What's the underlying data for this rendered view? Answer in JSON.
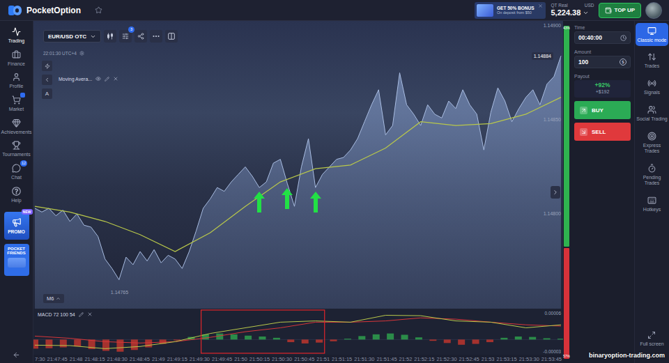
{
  "top_bar": {
    "logo": "PocketOption",
    "bonus": {
      "title": "GET 50% BONUS",
      "subtitle": "On deposit from $50"
    },
    "account": {
      "type": "QT Real",
      "currency": "USD",
      "balance": "5,224.38"
    },
    "top_up": "TOP UP"
  },
  "left_nav": {
    "items": [
      {
        "label": "Trading",
        "selected": true,
        "notify": false,
        "badge": null
      },
      {
        "label": "Finance",
        "selected": false,
        "notify": false,
        "badge": null
      },
      {
        "label": "Profile",
        "selected": false,
        "notify": false,
        "badge": null
      },
      {
        "label": "Market",
        "selected": false,
        "notify": true,
        "badge": null
      },
      {
        "label": "Achievements",
        "selected": false,
        "notify": false,
        "badge": null
      },
      {
        "label": "Tournaments",
        "selected": false,
        "notify": false,
        "badge": null
      },
      {
        "label": "Chat",
        "selected": false,
        "notify": false,
        "badge": "12"
      },
      {
        "label": "Help",
        "selected": false,
        "notify": false,
        "badge": null
      }
    ],
    "promo": {
      "label": "PROMO",
      "badge": "NEW"
    },
    "friends": {
      "label": "POCKET FRIENDS"
    }
  },
  "chart": {
    "symbol": "EUR/USD OTC",
    "indicator_count": "3",
    "time": "22:01:30 UTC+4",
    "text_tool": "A",
    "indicator": {
      "label": "Moving Avera..."
    },
    "timeframe": "M6",
    "price_axis": [
      {
        "label": "1.14900",
        "value": 1.149
      },
      {
        "label": "1.14850",
        "value": 1.1485
      },
      {
        "label": "1.14800",
        "value": 1.148
      }
    ],
    "current_price": {
      "label": "1.14884",
      "value": 1.14884
    },
    "low": {
      "label": "1.14765",
      "point": 12
    },
    "price": [
      1.14803,
      1.14801,
      1.14803,
      1.14799,
      1.14802,
      1.14796,
      1.148,
      1.14794,
      1.14793,
      1.14788,
      1.14776,
      1.14771,
      1.14765,
      1.14777,
      1.14773,
      1.1478,
      1.14775,
      1.14781,
      1.14774,
      1.14778,
      1.14776,
      1.14771,
      1.1478,
      1.14791,
      1.14803,
      1.14808,
      1.14814,
      1.14812,
      1.14817,
      1.14821,
      1.14825,
      1.1482,
      1.14814,
      1.14817,
      1.14827,
      1.14829,
      1.14816,
      1.14804,
      1.14825,
      1.1484,
      1.14814,
      1.14821,
      1.14825,
      1.14829,
      1.1483,
      1.14834,
      1.1484,
      1.14849,
      1.14858,
      1.14866,
      1.14842,
      1.14847,
      1.14875,
      1.14858,
      1.14853,
      1.14847,
      1.14858,
      1.14853,
      1.14851,
      1.1486,
      1.14856,
      1.14866,
      1.14858,
      1.14853,
      1.14834,
      1.14854,
      1.14867,
      1.1486,
      1.14849,
      1.14856,
      1.14862,
      1.14866,
      1.14858,
      1.14869,
      1.14873,
      1.14884
    ],
    "moving_average": [
      1.14804,
      1.14801,
      1.14796,
      1.14789,
      1.1478,
      1.1479,
      1.14804,
      1.14817,
      1.14824,
      1.14826,
      1.14835,
      1.14849,
      1.14847,
      1.14848,
      1.14853,
      1.14862
    ],
    "signal_arrows": [
      {
        "point": 32
      },
      {
        "point": 36
      },
      {
        "point": 40
      }
    ]
  },
  "macd": {
    "label": "MACD 72 100 54",
    "axis": [
      {
        "label": "0.00006",
        "value": 6e-05
      },
      {
        "label": "-0.00003",
        "value": -3e-05
      }
    ],
    "macd": [
      -1.3e-05,
      -1.4e-05,
      -2.1e-05,
      -1.6e-05,
      -5e-06,
      1.4e-05,
      2.7e-05,
      4e-05,
      4.3e-05,
      4e-05,
      5.6e-05,
      5.5e-05,
      4.3e-05,
      4e-05,
      2.7e-05,
      3.4e-05
    ],
    "signal": [
      8e-06,
      3e-06,
      -5e-06,
      -8e-06,
      -5e-06,
      5e-06,
      1.8e-05,
      2.7e-05,
      4e-05,
      4e-05,
      4.3e-05,
      5e-05,
      4.7e-05,
      4e-05,
      3.4e-05,
      3.1e-05
    ],
    "histogram": [
      -2.1e-05,
      -2e-05,
      -1.8e-05,
      -1.6e-05,
      -2.2e-05,
      -2.6e-05,
      -2.8e-05,
      -2.4e-05,
      -1.8e-05,
      -1e-05,
      -2e-06,
      6e-06,
      1.2e-05,
      1.4e-05,
      1.2e-05,
      9e-06,
      7e-06,
      4e-06,
      -6e-06,
      -9e-06,
      -7e-06,
      -4e-06,
      2e-06,
      8e-06,
      1.2e-05,
      1.4e-05,
      1.1e-05,
      5e-06,
      -3e-06,
      -8e-06,
      -1.2e-05,
      -1e-05,
      -6e-06,
      4e-06,
      7e-06,
      6e-06,
      3e-06,
      2e-06
    ],
    "highlight": {
      "from_point": 24,
      "to_point": 41
    }
  },
  "time_axis": [
    "7:30",
    "21:47:45",
    "21:48",
    "21:48:15",
    "21:48:30",
    "21:48:45",
    "21:49",
    "21:49:15",
    "21:49:30",
    "21:49:45",
    "21:50",
    "21:50:15",
    "21:50:30",
    "21:50:45",
    "21:51",
    "21:51:15",
    "21:51:30",
    "21:51:45",
    "21:52",
    "21:52:15",
    "21:52:30",
    "21:52:45",
    "21:53",
    "21:53:15",
    "21:53:30",
    "21:53:45"
  ],
  "sentiment": {
    "up_label": "43%",
    "down_label": "57%",
    "level": 0.67
  },
  "trade_panel": {
    "time": {
      "label": "Time",
      "value": "00:40:00"
    },
    "amount": {
      "label": "Amount",
      "value": "100",
      "currency": "$"
    },
    "payout": {
      "label": "Payout",
      "percent": "+92%",
      "profit": "+$192"
    },
    "buy": "BUY",
    "sell": "SELL"
  },
  "right_nav": {
    "items": [
      {
        "label": "Classic mode",
        "selected": true
      },
      {
        "label": "Trades",
        "selected": false
      },
      {
        "label": "Signals",
        "selected": false
      },
      {
        "label": "Social Trading",
        "selected": false
      },
      {
        "label": "Express Trades",
        "selected": false
      },
      {
        "label": "Pending Trades",
        "selected": false
      },
      {
        "label": "Hotkeys",
        "selected": false
      }
    ],
    "fullscreen": "Full screen"
  },
  "watermark": "binaryoption-trading.com"
}
